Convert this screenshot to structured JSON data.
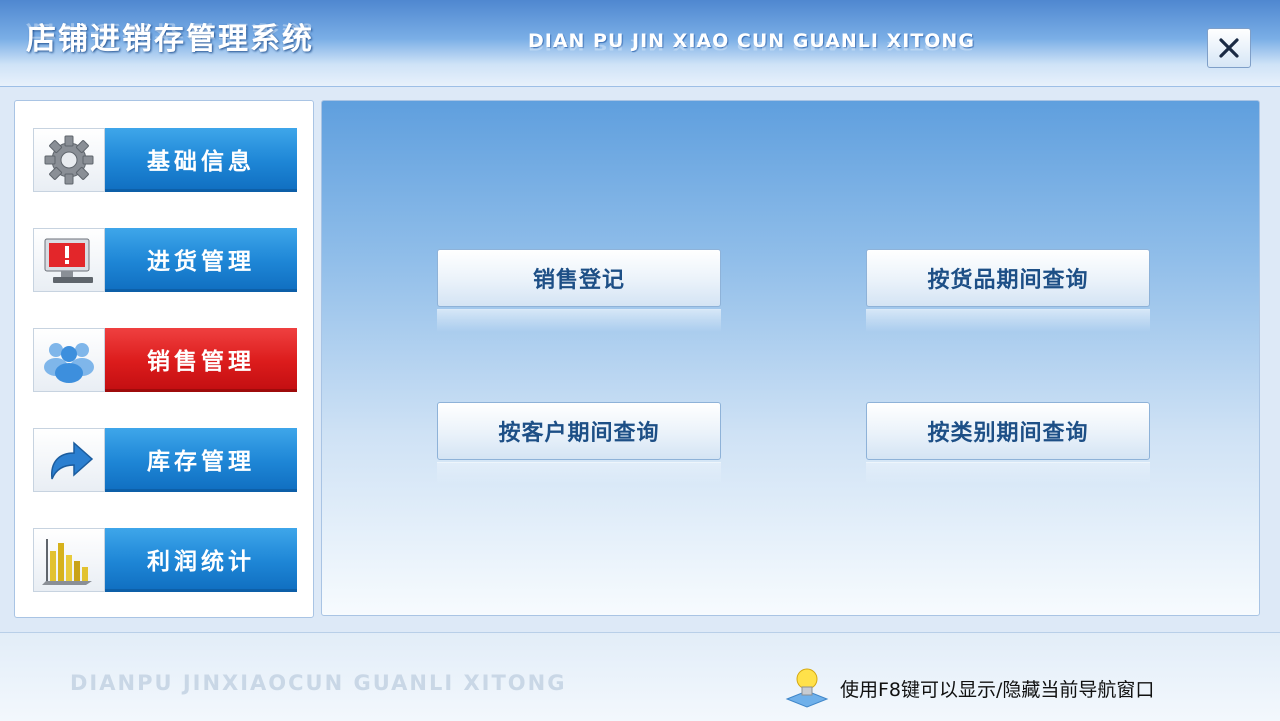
{
  "window": {
    "title_cn": "店铺进销存管理系统",
    "title_en": "DIAN PU JIN XIAO CUN GUANLI XITONG",
    "close_icon": "close-icon"
  },
  "nav": {
    "items": [
      {
        "label": "基础信息",
        "icon": "gear-icon",
        "active": false
      },
      {
        "label": "进货管理",
        "icon": "alert-monitor-icon",
        "active": false
      },
      {
        "label": "销售管理",
        "icon": "users-icon",
        "active": true
      },
      {
        "label": "库存管理",
        "icon": "arrow-icon",
        "active": false
      },
      {
        "label": "利润统计",
        "icon": "bar-chart-icon",
        "active": false
      }
    ]
  },
  "main": {
    "buttons": [
      {
        "label": "销售登记"
      },
      {
        "label": "按货品期间查询"
      },
      {
        "label": "按客户期间查询"
      },
      {
        "label": "按类别期间查询"
      }
    ]
  },
  "status": {
    "watermark": "DIANPU JINXIAOCUN GUANLI XITONG",
    "hint": "使用F8键可以显示/隐藏当前导航窗口",
    "hint_icon": "lightbulb-icon"
  },
  "colors": {
    "nav_blue": "#1e86d6",
    "nav_active_red": "#dc1c1c",
    "button_text": "#1d4f86"
  }
}
